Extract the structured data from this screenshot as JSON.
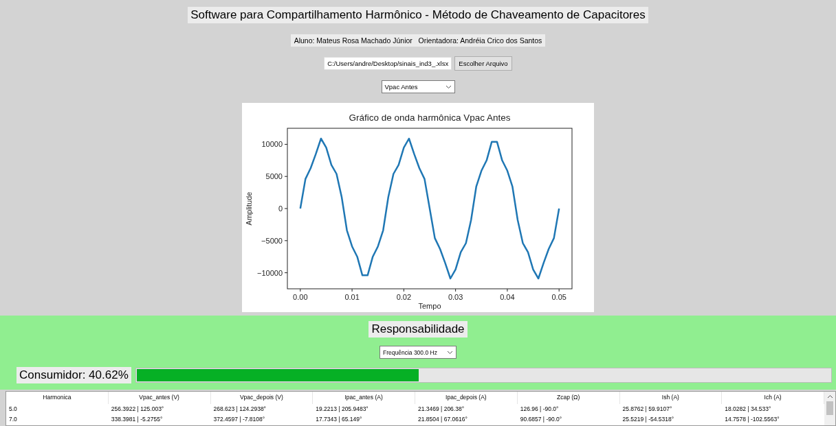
{
  "title": "Software para Compartilhamento Harmônico - Método de Chaveamento de Capacitores",
  "authors": "Aluno: Mateus Rosa Machado Júnior   Orientadora: Andréia Crico dos Santos",
  "file": {
    "value": "C:/Users/andre/Desktop/sinais_ind3_.xlsx",
    "button": "Escolher Arquivo"
  },
  "signal_select": {
    "value": "Vpac Antes"
  },
  "chart": {
    "chart_data": {
      "type": "line",
      "title": "Gráfico de onda harmônica Vpac Antes",
      "xlabel": "Tempo",
      "ylabel": "Amplitude",
      "x": [
        0,
        0.001,
        0.002,
        0.003,
        0.004,
        0.005,
        0.006,
        0.007,
        0.008,
        0.009,
        0.01,
        0.011,
        0.012,
        0.013,
        0.014,
        0.015,
        0.016,
        0.017,
        0.018,
        0.019,
        0.02,
        0.021,
        0.022,
        0.023,
        0.024,
        0.025,
        0.026,
        0.027,
        0.028,
        0.029,
        0.03,
        0.031,
        0.032,
        0.033,
        0.034,
        0.035,
        0.036,
        0.037,
        0.038,
        0.039,
        0.04,
        0.041,
        0.042,
        0.043,
        0.044,
        0.045,
        0.046,
        0.047,
        0.048,
        0.049,
        0.05
      ],
      "series": [
        {
          "color": "#1f77b4",
          "values": [
            0,
            4600,
            6300,
            8500,
            10900,
            9500,
            6800,
            5400,
            1800,
            -3400,
            -5900,
            -7500,
            -10400,
            -10400,
            -7500,
            -5900,
            -3400,
            1800,
            5400,
            6800,
            9500,
            10900,
            8500,
            6300,
            4600,
            0,
            -4600,
            -6300,
            -8500,
            -10900,
            -9500,
            -6800,
            -5400,
            -1800,
            3400,
            5900,
            7500,
            10400,
            10400,
            7500,
            5900,
            3400,
            -1800,
            -5400,
            -6800,
            -9500,
            -10900,
            -8500,
            -6300,
            -4600,
            0
          ]
        }
      ],
      "xlim": [
        -0.0025,
        0.0525
      ],
      "ylim": [
        -12500,
        12500
      ],
      "xticks": [
        {
          "value": 0,
          "label": "0.00"
        },
        {
          "value": 0.01,
          "label": "0.01"
        },
        {
          "value": 0.02,
          "label": "0.02"
        },
        {
          "value": 0.03,
          "label": "0.03"
        },
        {
          "value": 0.04,
          "label": "0.04"
        },
        {
          "value": 0.05,
          "label": "0.05"
        }
      ],
      "yticks": [
        {
          "value": 10000,
          "label": "10000"
        },
        {
          "value": 5000,
          "label": "5000"
        },
        {
          "value": 0,
          "label": "0"
        },
        {
          "value": -5000,
          "label": "−5000"
        },
        {
          "value": -10000,
          "label": "−10000"
        }
      ]
    }
  },
  "responsibility": {
    "title": "Responsabilidade",
    "frequency_select": {
      "value": "Frequência 300.0 Hz"
    },
    "consumer": {
      "label": "Consumidor: 40.62%",
      "level": 0.4062
    }
  },
  "table": {
    "columns": [
      "Harmonica",
      "Vpac_antes (V)",
      "Vpac_depois (V)",
      "Ipac_antes (A)",
      "Ipac_depois (A)",
      "Zcap (Ω)",
      "Ish (A)",
      "Ich (A)"
    ],
    "rows": [
      [
        "5.0",
        "256.3922 | 125.003°",
        "268.623 | 124.2938°",
        "19.2213 | 205.9483°",
        "21.3469 | 206.38°",
        "126.96 | -90.0°",
        "25.8762 | 59.9107°",
        "18.0282 | 34.533°"
      ],
      [
        "7.0",
        "338.3981 | -5.2755°",
        "372.4597 | -7.8108°",
        "17.7343 | 65.149°",
        "21.8504 | 67.0616°",
        "90.6857 | -90.0°",
        "25.5219 | -54.5318°",
        "14.7578 | -102.5563°"
      ]
    ]
  }
}
